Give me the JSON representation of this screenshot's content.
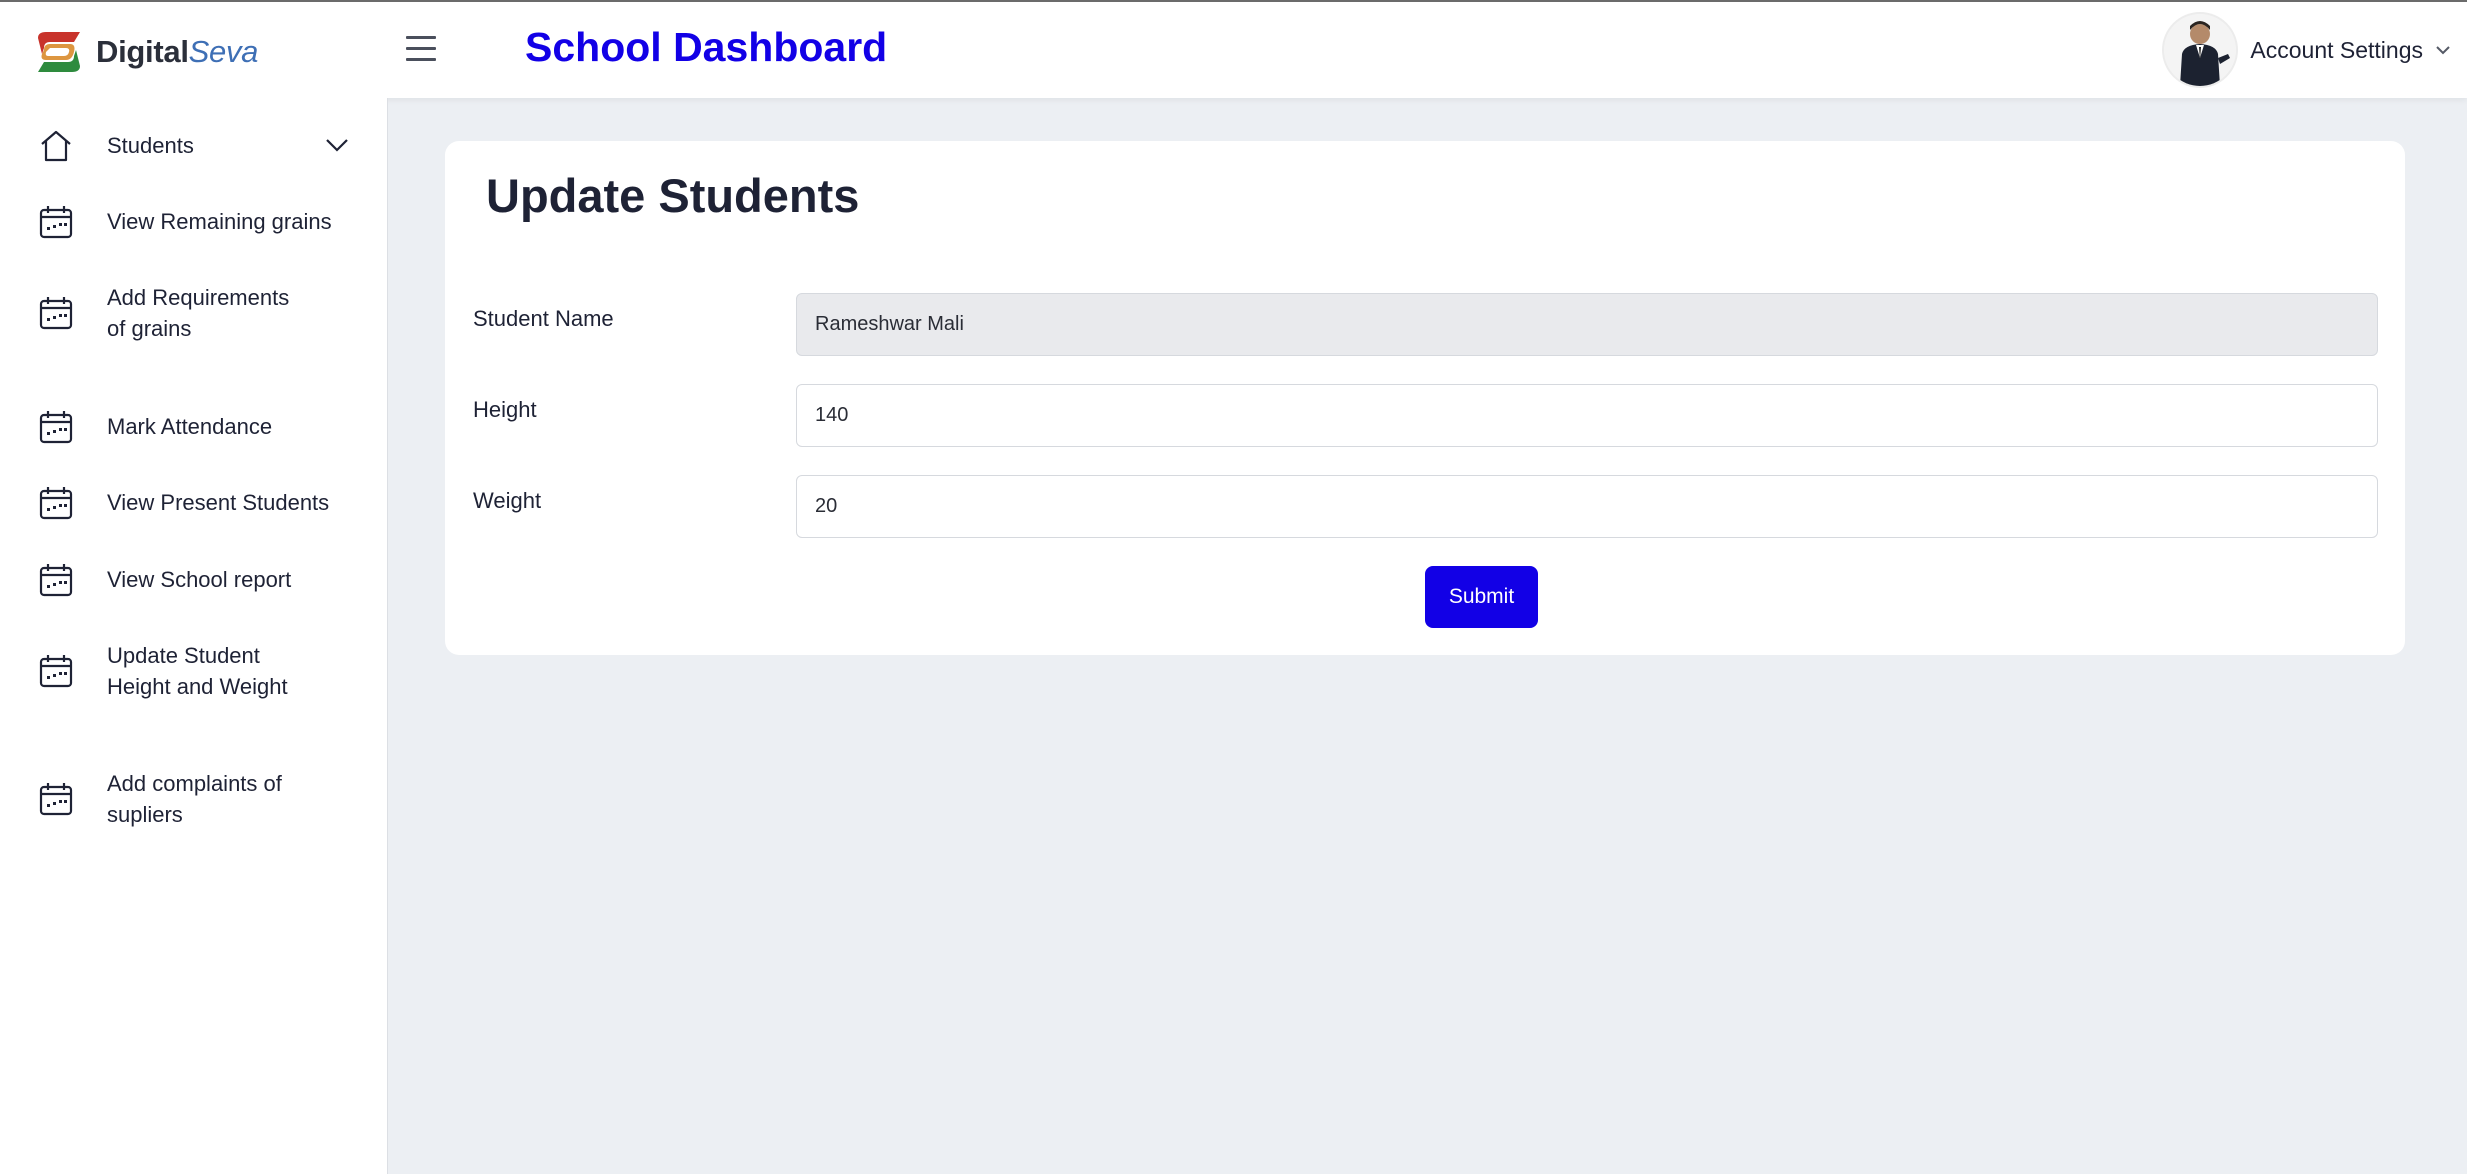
{
  "header": {
    "logo": {
      "part1": "Digital",
      "part2": "Seva"
    },
    "menu_icon": "hamburger-menu-icon",
    "title": "School Dashboard",
    "account": {
      "label": "Account Settings",
      "icon": "chevron-down-icon"
    }
  },
  "sidebar": {
    "items": [
      {
        "label": "Students",
        "icon": "home-icon",
        "expandable": true
      },
      {
        "label": "View Remaining grains",
        "icon": "calendar-icon"
      },
      {
        "label": "Add Requirements\nof grains",
        "icon": "calendar-icon"
      },
      {
        "label": "Mark Attendance",
        "icon": "calendar-icon"
      },
      {
        "label": "View Present Students",
        "icon": "calendar-icon"
      },
      {
        "label": "View School report",
        "icon": "calendar-icon"
      },
      {
        "label": "Update Student\nHeight and Weight",
        "icon": "calendar-icon"
      },
      {
        "label": "Add complaints of\nsupliers",
        "icon": "calendar-icon"
      }
    ]
  },
  "form": {
    "title": "Update Students",
    "fields": [
      {
        "label": "Student Name",
        "value": "Rameshwar Mali",
        "readonly": true
      },
      {
        "label": "Height",
        "value": "140"
      },
      {
        "label": "Weight",
        "value": "20"
      }
    ],
    "submit_label": "Submit"
  },
  "colors": {
    "brand_blue": "#1200e6",
    "background": "#eceff3",
    "card": "#ffffff",
    "readonly_input": "#e9eaed"
  }
}
